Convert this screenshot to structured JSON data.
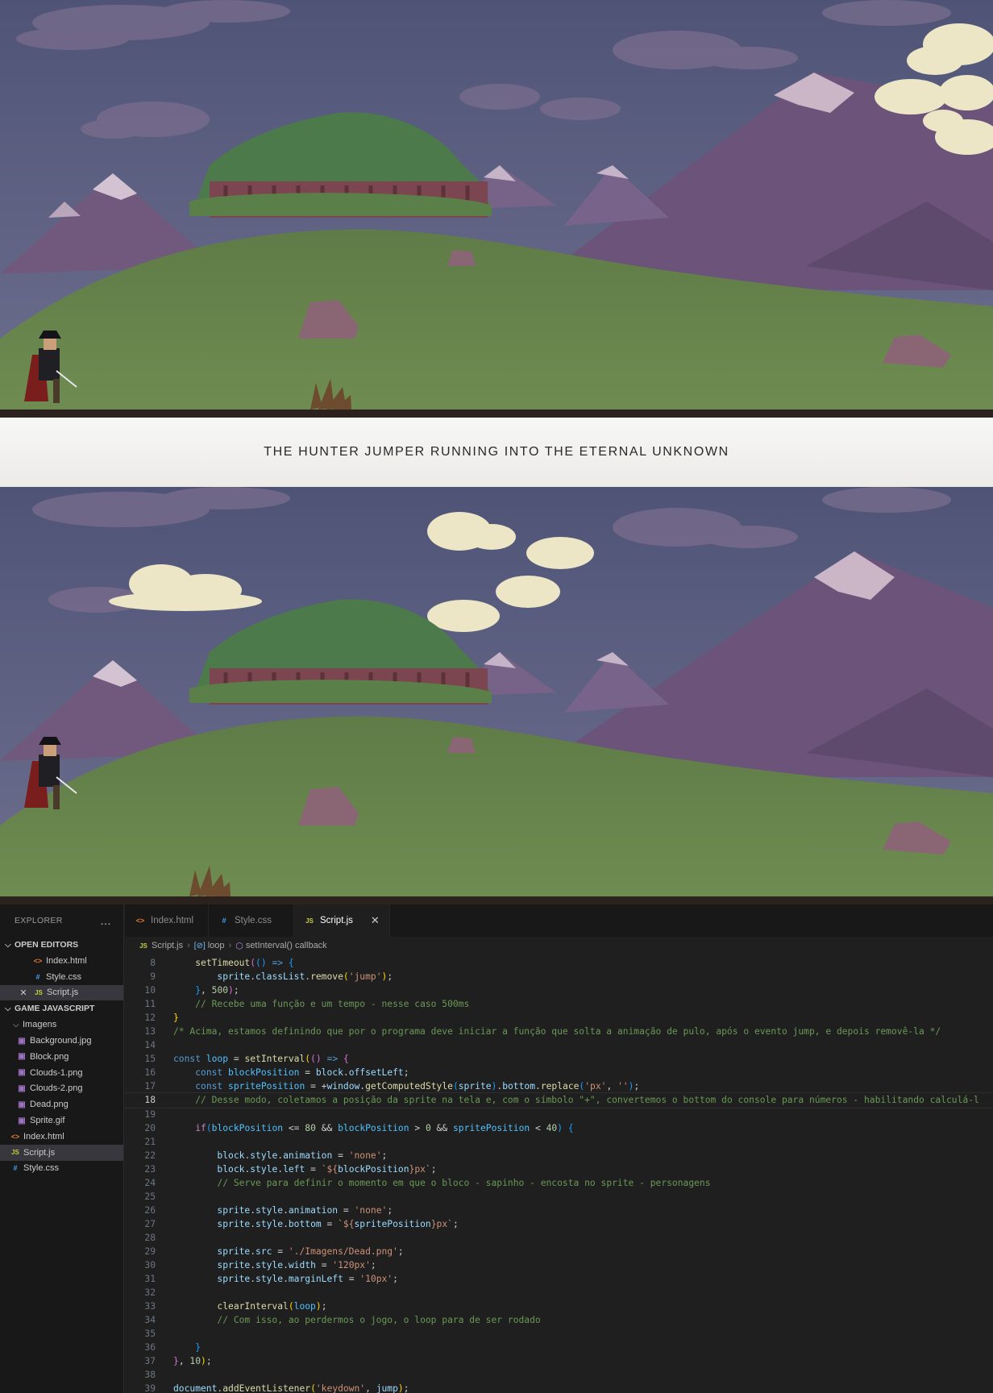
{
  "caption": "THE HUNTER JUMPER RUNNING INTO THE ETERNAL UNKNOWN",
  "scenes": [
    {
      "id": "scene-top",
      "sprite": "hunter-sprite",
      "obstacle": "plant-block"
    },
    {
      "id": "scene-bottom",
      "sprite": "hunter-sprite",
      "obstacle": "plant-block"
    }
  ],
  "colors": {
    "sky": "#5b5f82",
    "mountain": "#6e5a80",
    "grass": "#5f7a4a",
    "ground": "#2b211d",
    "editor_bg": "#1f1f1f",
    "sidebar_bg": "#181818"
  },
  "explorer": {
    "title": "EXPLORER",
    "more_icon": "…",
    "open_editors_label": "OPEN EDITORS",
    "open_editors": [
      {
        "icon": "html-file-icon",
        "glyph": "<>",
        "name": "Index.html",
        "close": ""
      },
      {
        "icon": "css-file-icon",
        "glyph": "#",
        "name": "Style.css",
        "close": ""
      },
      {
        "icon": "js-file-icon",
        "glyph": "JS",
        "name": "Script.js",
        "close": "✕"
      }
    ],
    "project_label": "GAME JAVASCRIPT",
    "folder_name": "Imagens",
    "images": [
      "Background.jpg",
      "Block.png",
      "Clouds-1.png",
      "Clouds-2.png",
      "Dead.png",
      "Sprite.gif"
    ],
    "root_files": [
      {
        "icon": "html-file-icon",
        "glyph": "<>",
        "name": "Index.html"
      },
      {
        "icon": "js-file-icon",
        "glyph": "JS",
        "name": "Script.js"
      },
      {
        "icon": "css-file-icon",
        "glyph": "#",
        "name": "Style.css"
      }
    ]
  },
  "tabs": [
    {
      "glyph": "<>",
      "icon": "html-file-icon",
      "label": "Index.html"
    },
    {
      "glyph": "#",
      "icon": "css-file-icon",
      "label": "Style.css"
    },
    {
      "glyph": "JS",
      "icon": "js-file-icon",
      "label": "Script.js",
      "close": "✕"
    }
  ],
  "breadcrumb": {
    "file": "Script.js",
    "symbol": "loop",
    "callback": "setInterval() callback"
  },
  "editor": {
    "current_line": 18,
    "lines": [
      {
        "n": "8",
        "html": "    <span class='f'>setTimeout</span><span class='br2'>(</span><span class='br3'>()</span> <span class='k'>=&gt;</span> <span class='br3'>{</span>"
      },
      {
        "n": "9",
        "html": "        <span class='v'>sprite</span>.<span class='v'>classList</span>.<span class='f'>remove</span><span class='br1'>(</span><span class='s'>'jump'</span><span class='br1'>)</span>;"
      },
      {
        "n": "10",
        "html": "    <span class='br3'>}</span>, <span class='n'>500</span><span class='br2'>)</span>;"
      },
      {
        "n": "11",
        "html": "    <span class='c'>// Recebe uma função e um tempo - nesse caso 500ms</span>"
      },
      {
        "n": "12",
        "html": "<span class='br1'>}</span>"
      },
      {
        "n": "13",
        "html": "<span class='c'>/* Acima, estamos definindo que por o programa deve iniciar a função que solta a animação de pulo, após o evento jump, e depois removê-la */</span>"
      },
      {
        "n": "14",
        "html": ""
      },
      {
        "n": "15",
        "html": "<span class='k'>const</span> <span class='vc'>loop</span> = <span class='f'>setInterval</span><span class='br1'>(</span><span class='br2'>()</span> <span class='k'>=&gt;</span> <span class='br2'>{</span>"
      },
      {
        "n": "16",
        "html": "    <span class='k'>const</span> <span class='vc'>blockPosition</span> = <span class='v'>block</span>.<span class='v'>offsetLeft</span>;"
      },
      {
        "n": "17",
        "html": "    <span class='k'>const</span> <span class='vc'>spritePosition</span> = +<span class='v'>window</span>.<span class='f'>getComputedStyle</span><span class='br3'>(</span><span class='v'>sprite</span><span class='br3'>)</span>.<span class='v'>bottom</span>.<span class='f'>replace</span><span class='br3'>(</span><span class='s'>'px'</span>, <span class='s'>''</span><span class='br3'>)</span>;"
      },
      {
        "n": "18",
        "html": "    <span class='c'>// Desse modo, coletamos a posição da sprite na tela e, com o símbolo \"+\", convertemos o bottom do console para números - habilitando calculá-l</span>"
      },
      {
        "n": "19",
        "html": ""
      },
      {
        "n": "20",
        "html": "    <span class='kc'>if</span><span class='br3'>(</span><span class='vc'>blockPosition</span> &lt;= <span class='n'>80</span> &amp;&amp; <span class='vc'>blockPosition</span> &gt; <span class='n'>0</span> &amp;&amp; <span class='vc'>spritePosition</span> &lt; <span class='n'>40</span><span class='br3'>)</span> <span class='br3'>{</span>"
      },
      {
        "n": "21",
        "html": ""
      },
      {
        "n": "22",
        "html": "        <span class='v'>block</span>.<span class='v'>style</span>.<span class='v'>animation</span> = <span class='s'>'none'</span>;"
      },
      {
        "n": "23",
        "html": "        <span class='v'>block</span>.<span class='v'>style</span>.<span class='v'>left</span> = <span class='s'>`${</span><span class='v'>blockPosition</span><span class='s'>}px`</span>;"
      },
      {
        "n": "24",
        "html": "        <span class='c'>// Serve para definir o momento em que o bloco - sapinho - encosta no sprite - personagens</span>"
      },
      {
        "n": "25",
        "html": ""
      },
      {
        "n": "26",
        "html": "        <span class='v'>sprite</span>.<span class='v'>style</span>.<span class='v'>animation</span> = <span class='s'>'none'</span>;"
      },
      {
        "n": "27",
        "html": "        <span class='v'>sprite</span>.<span class='v'>style</span>.<span class='v'>bottom</span> = <span class='s'>`${</span><span class='v'>spritePosition</span><span class='s'>}px`</span>;"
      },
      {
        "n": "28",
        "html": ""
      },
      {
        "n": "29",
        "html": "        <span class='v'>sprite</span>.<span class='v'>src</span> = <span class='s'>'./Imagens/Dead.png'</span>;"
      },
      {
        "n": "30",
        "html": "        <span class='v'>sprite</span>.<span class='v'>style</span>.<span class='v'>width</span> = <span class='s'>'120px'</span>;"
      },
      {
        "n": "31",
        "html": "        <span class='v'>sprite</span>.<span class='v'>style</span>.<span class='v'>marginLeft</span> = <span class='s'>'10px'</span>;"
      },
      {
        "n": "32",
        "html": ""
      },
      {
        "n": "33",
        "html": "        <span class='f'>clearInterval</span><span class='br1'>(</span><span class='vc'>loop</span><span class='br1'>)</span>;"
      },
      {
        "n": "34",
        "html": "        <span class='c'>// Com isso, ao perdermos o jogo, o loop para de ser rodado</span>"
      },
      {
        "n": "35",
        "html": ""
      },
      {
        "n": "36",
        "html": "    <span class='br3'>}</span>"
      },
      {
        "n": "37",
        "html": "<span class='br2'>}</span>, <span class='n'>10</span><span class='br1'>)</span>;"
      },
      {
        "n": "38",
        "html": ""
      },
      {
        "n": "39",
        "html": "<span class='v'>document</span>.<span class='f'>addEventListener</span><span class='br1'>(</span><span class='s'>'keydown'</span>, <span class='v'>jump</span><span class='br1'>)</span>;"
      }
    ]
  }
}
